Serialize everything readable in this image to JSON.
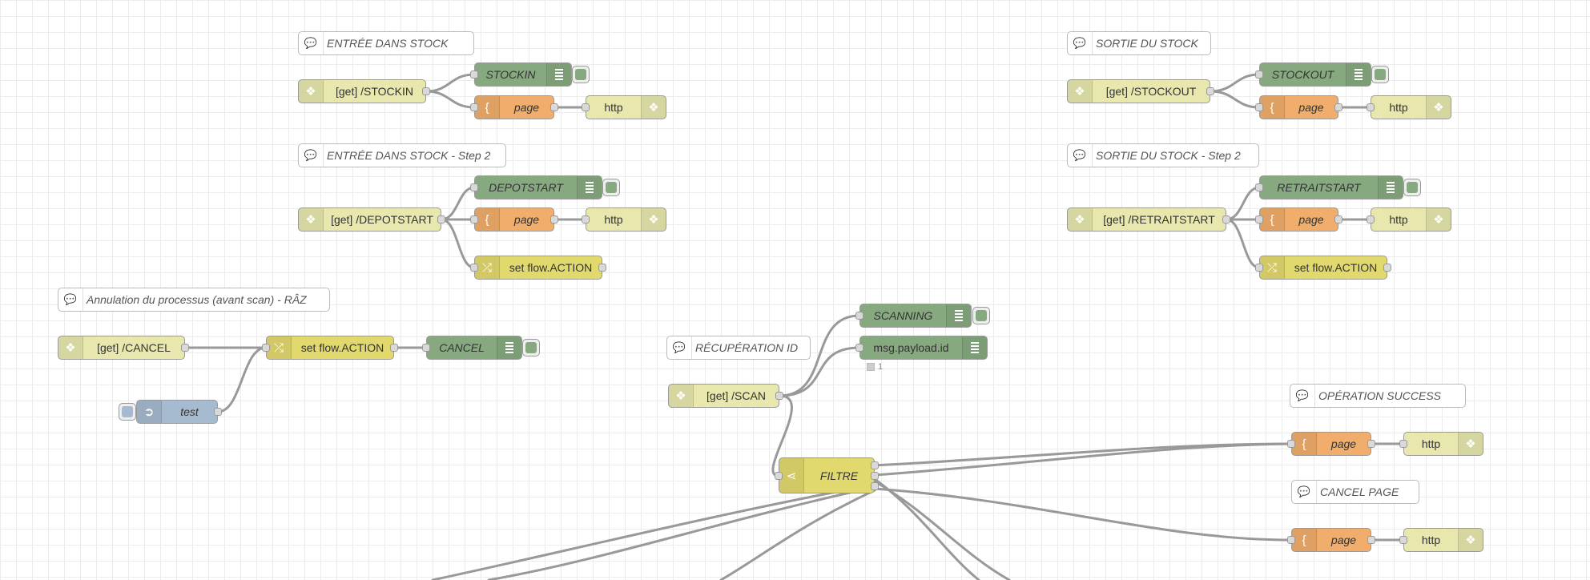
{
  "comments": {
    "stockin_title": "ENTRÉE DANS STOCK",
    "stockin_step2": "ENTRÉE DANS STOCK - Step 2",
    "stockout_title": "SORTIE DU STOCK",
    "stockout_step2": "SORTIE DU STOCK - Step 2",
    "cancel_title": "Annulation du processus (avant scan) - RÂZ",
    "recup_id": "RÉCUPÉRATION ID",
    "op_success": "OPÉRATION SUCCESS",
    "cancel_page": "CANCEL PAGE"
  },
  "http_in": {
    "stockin": "[get] /STOCKIN",
    "depotstart": "[get] /DEPOTSTART",
    "stockout": "[get] /STOCKOUT",
    "retraitstart": "[get] /RETRAITSTART",
    "cancel": "[get] /CANCEL",
    "scan": "[get] /SCAN"
  },
  "debug": {
    "stockin": "STOCKIN",
    "depotstart": "DEPOTSTART",
    "stockout": "STOCKOUT",
    "retraitstart": "RETRAITSTART",
    "cancel": "CANCEL",
    "scanning": "SCANNING",
    "payload": "msg.payload.id",
    "payload_status": "1"
  },
  "templates": {
    "label": "page"
  },
  "responses": {
    "label": "http"
  },
  "change": {
    "label": "set flow.ACTION"
  },
  "switch": {
    "label": "FILTRE"
  },
  "inject": {
    "label": "test"
  },
  "colors": {
    "http_node": "#e7e7ae",
    "template_node": "#f0ad6b",
    "change_node": "#e2d96e",
    "debug_node": "#87a980",
    "inject_node": "#a6bbcf",
    "wire": "#999999"
  },
  "icons": {
    "comment": "comment-icon",
    "http": "globe-icon",
    "template": "brace-icon",
    "change": "shuffle-icon",
    "switch": "switch-icon",
    "debug": "list-icon",
    "inject": "arrow-icon"
  }
}
